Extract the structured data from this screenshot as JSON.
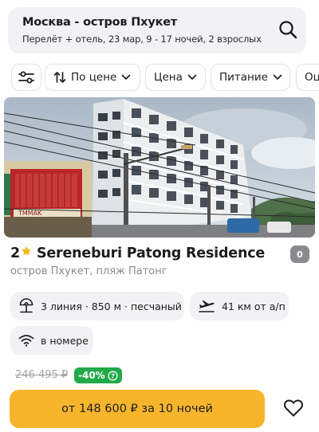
{
  "search": {
    "title": "Москва - остров Пхукет",
    "subtitle": "Перелёт + отель, 23 мар, 9 - 17 ночей, 2 взрослых",
    "icon": "search-icon"
  },
  "filters": {
    "settings_icon": "filter-settings-icon",
    "sort_label": "По цене",
    "price_label": "Цена",
    "meal_label": "Питание",
    "more_label": "Оц"
  },
  "hotel": {
    "stars": "2",
    "name": "Sereneburi Patong Residence",
    "review_score": "0",
    "location": "остров Пхукет, пляж Патонг",
    "beach_info": "3 линия · 850 м · песчаный",
    "airport_info": "41 км от а/п",
    "wifi_info": "в номере",
    "sign_text": "TMMAK"
  },
  "pricing": {
    "old_price": "246 495 ₽",
    "discount": "-40%",
    "button_label": "от 148 600 ₽ за 10 ночей"
  },
  "colors": {
    "accent": "#f7b52c",
    "discount": "#22a94a",
    "star": "#f5b417",
    "chip_bg": "#f2f2f4"
  }
}
